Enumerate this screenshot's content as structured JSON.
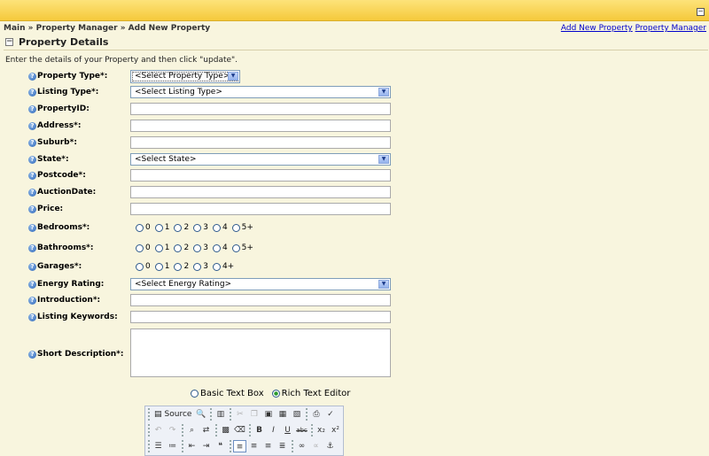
{
  "header": {
    "minimize_icon": "minimize-icon"
  },
  "breadcrumb": "Main » Property Manager » Add New Property",
  "links": {
    "add_new": "Add New Property",
    "manager": "Property Manager"
  },
  "section": {
    "title": "Property Details"
  },
  "intro": "Enter the details of your Property and then click \"update\".",
  "fields": {
    "property_type": {
      "label": "Property Type*:",
      "value": "<Select Property Type>"
    },
    "listing_type": {
      "label": "Listing Type*:",
      "value": "<Select Listing Type>"
    },
    "property_id": {
      "label": "PropertyID:"
    },
    "address": {
      "label": "Address*:"
    },
    "suburb": {
      "label": "Suburb*:"
    },
    "state": {
      "label": "State*:",
      "value": "<Select State>"
    },
    "postcode": {
      "label": "Postcode*:"
    },
    "auction_date": {
      "label": "AuctionDate:"
    },
    "price": {
      "label": "Price:"
    },
    "bedrooms": {
      "label": "Bedrooms*:",
      "options": [
        "0",
        "1",
        "2",
        "3",
        "4",
        "5+"
      ]
    },
    "bathrooms": {
      "label": "Bathrooms*:",
      "options": [
        "0",
        "1",
        "2",
        "3",
        "4",
        "5+"
      ]
    },
    "garages": {
      "label": "Garages*:",
      "options": [
        "0",
        "1",
        "2",
        "3",
        "4+"
      ]
    },
    "energy_rating": {
      "label": "Energy Rating:",
      "value": "<Select Energy Rating>"
    },
    "introduction": {
      "label": "Introduction*:"
    },
    "listing_keywords": {
      "label": "Listing Keywords:"
    },
    "short_description": {
      "label": "Short Description*:"
    }
  },
  "editor_mode": {
    "basic": "Basic Text Box",
    "rich": "Rich Text Editor",
    "selected": "rich"
  },
  "toolbar": {
    "source": "Source",
    "bold": "B",
    "italic": "I",
    "underline": "U",
    "strike": "abc",
    "subscript": "x₂",
    "superscript": "x²"
  }
}
